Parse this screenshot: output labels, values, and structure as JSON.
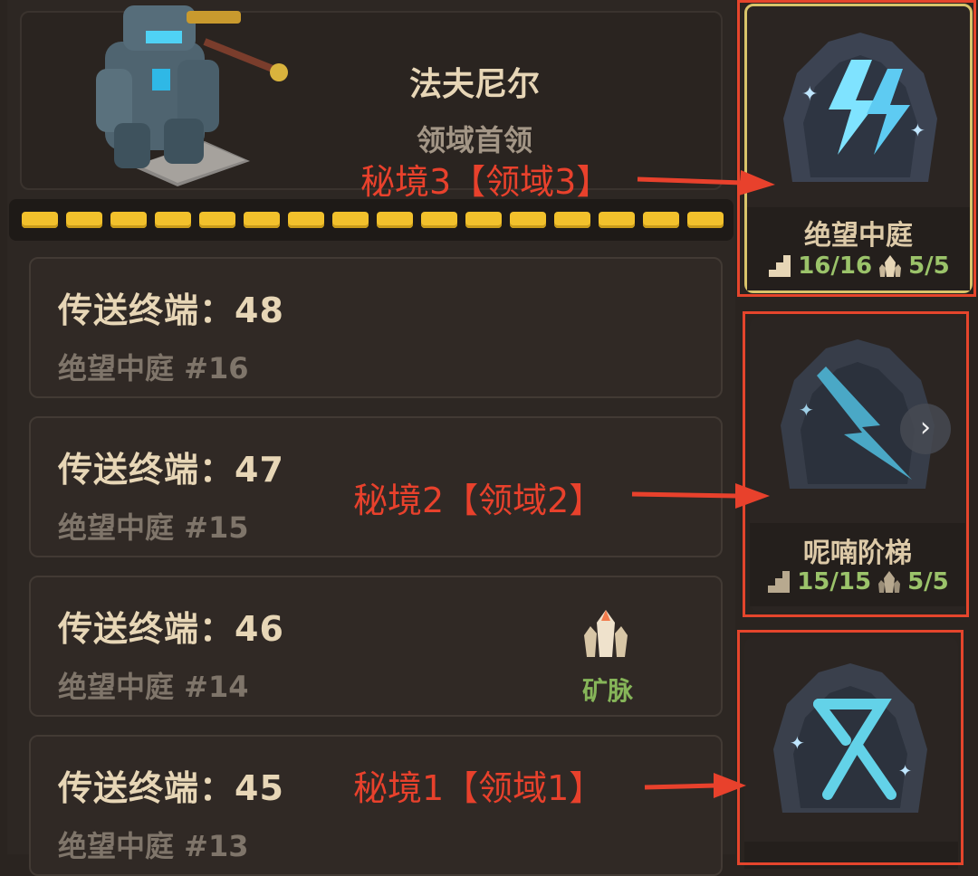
{
  "boss": {
    "name": "法夫尼尔",
    "subtitle": "领域首领"
  },
  "progress": {
    "segments_filled": 16,
    "segments_total": 16,
    "color": "#f2c12c"
  },
  "terminals": [
    {
      "title": "传送终端：48",
      "subtitle": "绝望中庭 #16",
      "has_mine": false
    },
    {
      "title": "传送终端：47",
      "subtitle": "绝望中庭 #15",
      "has_mine": false
    },
    {
      "title": "传送终端：46",
      "subtitle": "绝望中庭 #14",
      "has_mine": true,
      "mine_label": "矿脉"
    },
    {
      "title": "传送终端：45",
      "subtitle": "绝望中庭 #13",
      "has_mine": false
    }
  ],
  "realms": [
    {
      "name": "绝望中庭",
      "floors": "16/16",
      "mines": "5/5",
      "icon": "double-lightning-icon",
      "selected": true
    },
    {
      "name": "呢喃阶梯",
      "floors": "15/15",
      "mines": "5/5",
      "icon": "lightning-bolt-icon",
      "selected": false
    },
    {
      "name": "",
      "icon": "rune-icon",
      "selected": false
    }
  ],
  "annotations": {
    "realm3": "秘境3【领域3】",
    "realm2": "秘境2【领域2】",
    "realm1": "秘境1【领域1】"
  },
  "next_button": "›",
  "colors": {
    "annotation": "#e8412c",
    "accent_gold": "#f2c12c",
    "stat_green": "#9bc36a",
    "selected_border": "#d8c46a"
  }
}
